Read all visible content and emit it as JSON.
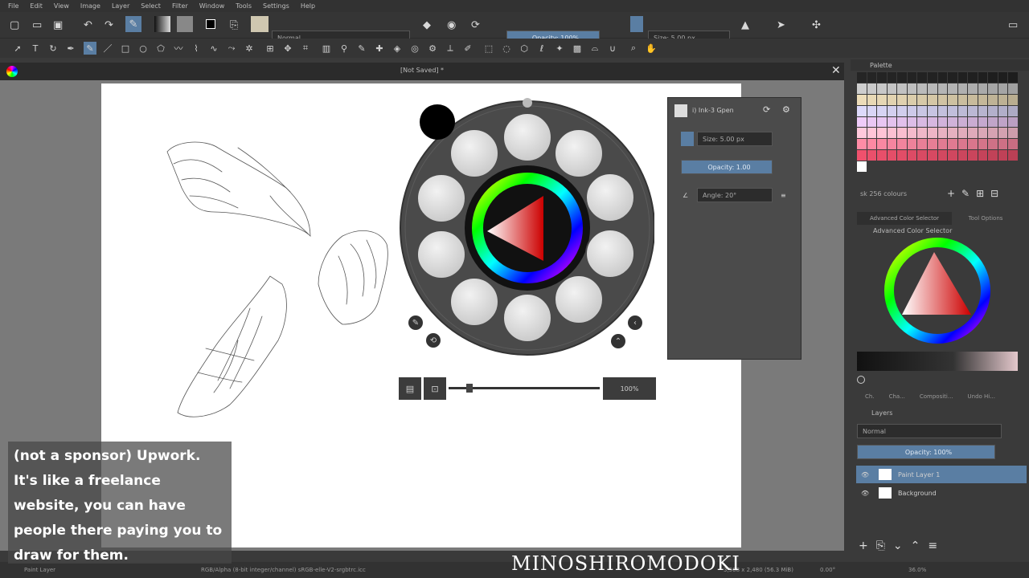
{
  "menu": [
    "File",
    "Edit",
    "View",
    "Image",
    "Layer",
    "Select",
    "Filter",
    "Window",
    "Tools",
    "Settings",
    "Help"
  ],
  "toolbar": {
    "blend_mode": "Normal",
    "opacity": "Opacity: 100%",
    "size": "Size: 5.00 px"
  },
  "document_tab": {
    "title": "[Not Saved] *"
  },
  "popup_palette": {
    "zoom": "100%",
    "brush_name": "i) Ink-3 Gpen",
    "size": "Size: 5.00 px",
    "opacity": "Opacity: 1.00",
    "angle": "Angle: 20°"
  },
  "palette_docker": {
    "title": "Palette",
    "palette_name": "sk 256 colours",
    "colors": {
      "bg": "#3a3a3a",
      "accent": "#5a7ea3"
    }
  },
  "color_docker": {
    "tabs": [
      "Advanced Color Selector",
      "Tool Options"
    ],
    "title": "Advanced Color Selector"
  },
  "mid_tabs": [
    "Ch.",
    "Cha...",
    "Compositi...",
    "Undo Hi..."
  ],
  "layers_docker": {
    "title": "Layers",
    "blend": "Normal",
    "opacity": "Opacity: 100%",
    "layers": [
      {
        "name": "Paint Layer 1"
      },
      {
        "name": "Background"
      }
    ]
  },
  "status": {
    "layer": "Paint Layer",
    "color_info": "RGB/Alpha (8-bit integer/channel)  sRGB-elle-V2-srgbtrc.icc",
    "size_info": "3,508 x 2,480 (56.3 MiB)",
    "angle": "0.00°",
    "zoom": "36.0%"
  },
  "caption_lines": [
    "(not a sponsor) Upwork.",
    "It's like a freelance",
    "website, you can have",
    "people there paying you to",
    "draw for them."
  ],
  "watermark": "MINOSHIROMODOKI"
}
